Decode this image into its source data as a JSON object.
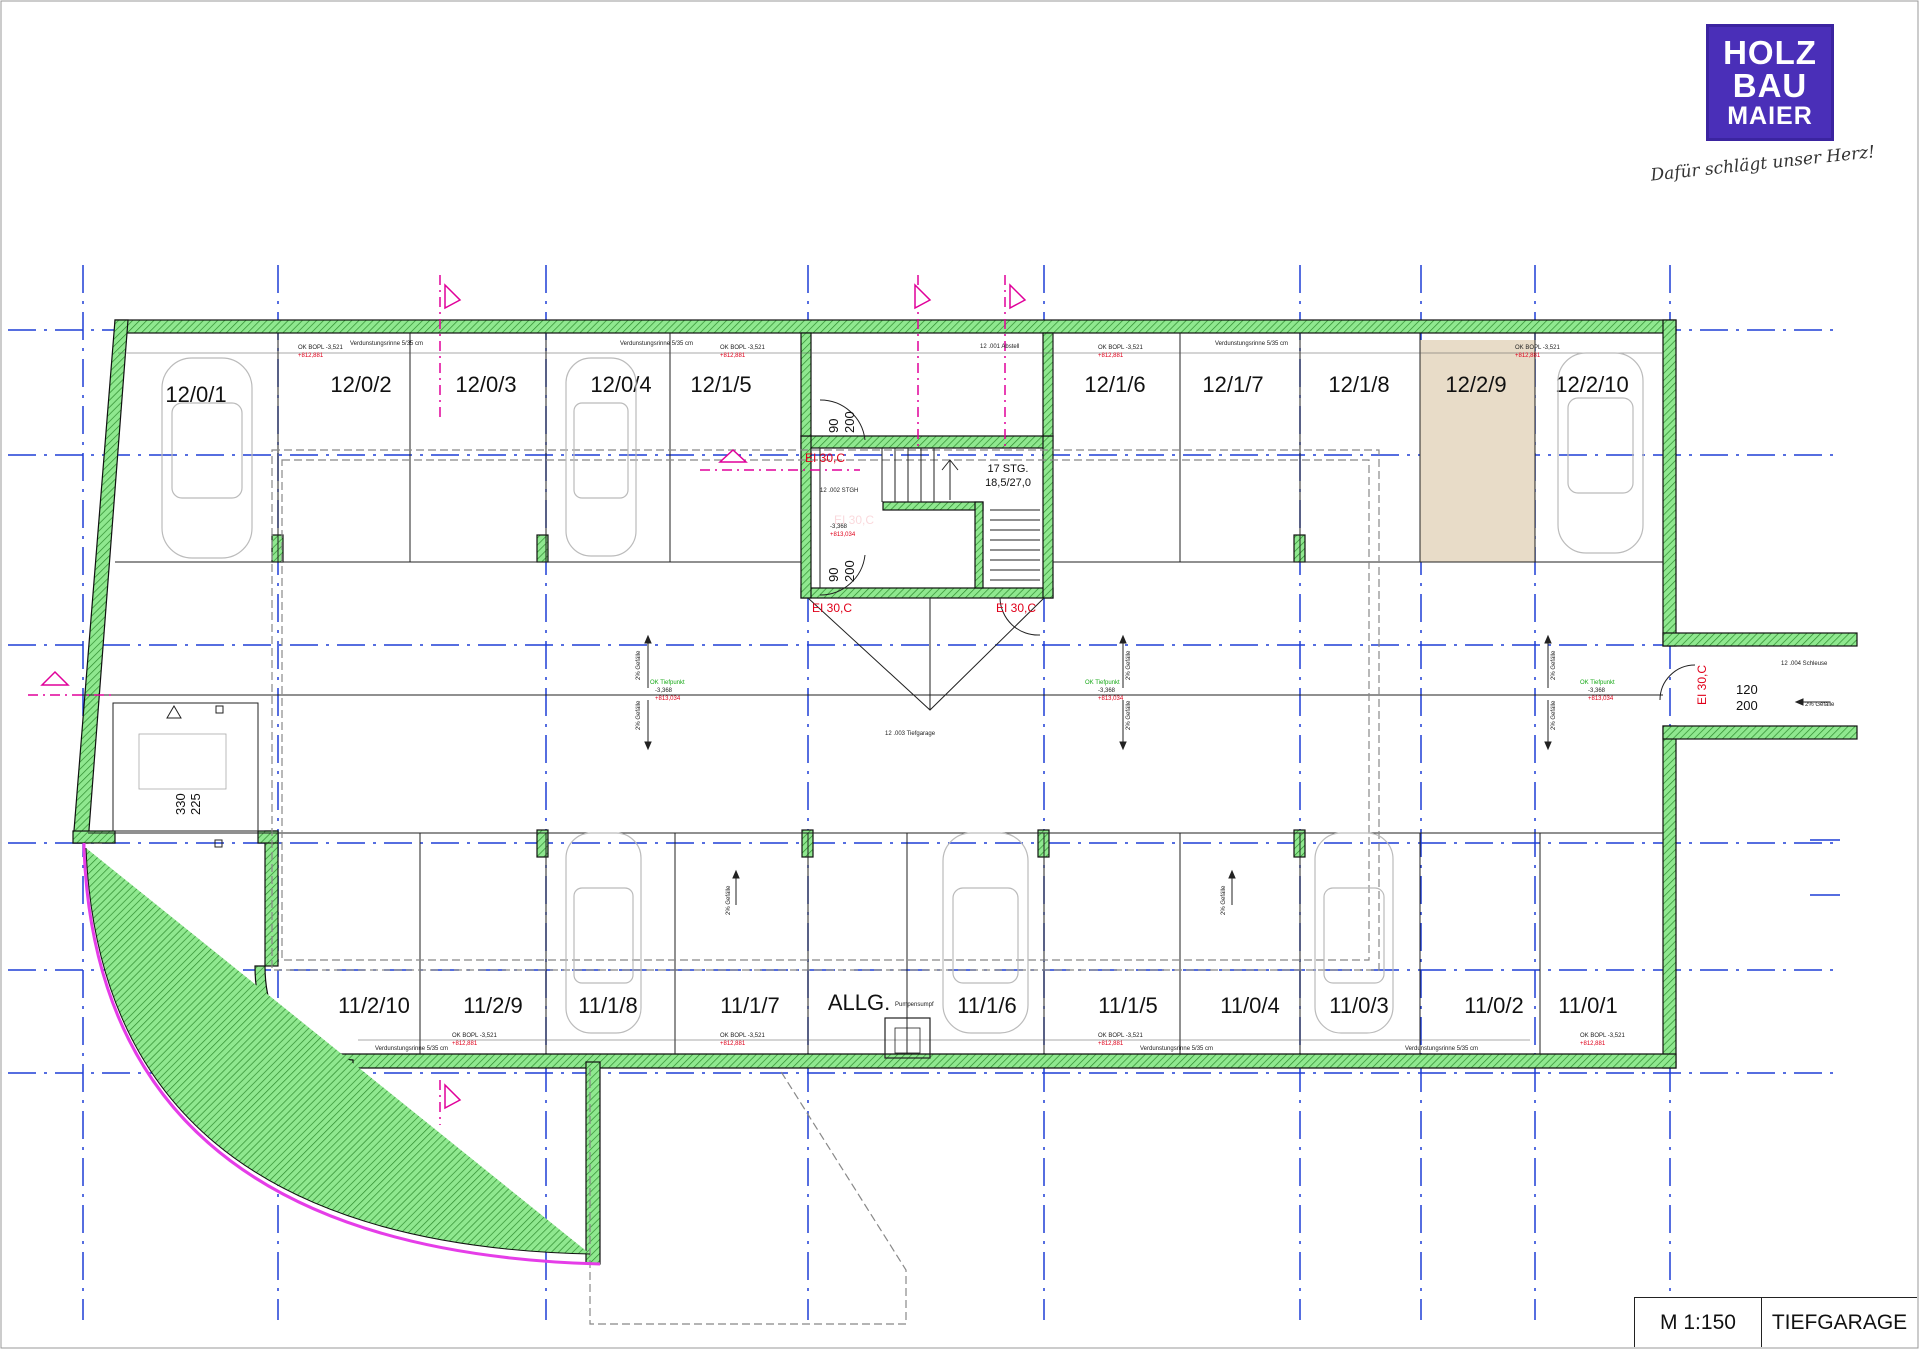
{
  "logo": {
    "line1": "HOLZ",
    "line2": "BAU",
    "line3": "MAIER",
    "color": "#4a2fb8"
  },
  "slogan": "Dafür schlägt unser Herz!",
  "title_block": {
    "scale": "M 1:150",
    "name": "TIEFGARAGE"
  },
  "colors": {
    "wall_fill": "#8fe88f",
    "wall_hatch": "#2e8b2e",
    "axis": "#1f3fd6",
    "section": "#e0009a",
    "highlight_spot": "#e8dcc8",
    "ramp_outline": "#e53de8"
  },
  "top_spots": [
    "12/0/1",
    "12/0/2",
    "12/0/3",
    "12/0/4",
    "12/1/5",
    "12/1/6",
    "12/1/7",
    "12/1/8",
    "12/2/9",
    "12/2/10"
  ],
  "bottom_spots": [
    "11/2/10",
    "11/2/9",
    "11/1/8",
    "11/1/7",
    "ALLG.",
    "11/1/6",
    "11/1/5",
    "11/0/4",
    "11/0/3",
    "11/0/2",
    "11/0/1"
  ],
  "stair": {
    "steps": "17 STG.",
    "ratio": "18,5/27,0"
  },
  "doors": {
    "fire_rating": "EI 30,C",
    "dim_top_w": "90",
    "dim_top_h": "200",
    "dim_sluice_w": "120",
    "dim_sluice_h": "200",
    "dim_lift_w": "330",
    "dim_lift_h": "225"
  },
  "small_labels": {
    "level": "OK BOPL -3,521",
    "level_abs": "+812,881",
    "drain": "Verdunstungsrinne 5/35 cm",
    "slope": "2% Gefälle",
    "room_garage": "12 .003 Tiefgarage",
    "room_stair": "12 .002 STGH",
    "room_storage": "12 .001 Abstell",
    "room_sluice": "12 .004 Schleuse",
    "pump": "Pumpensumpf",
    "lowpoint": "-3,368",
    "lowpoint_abs": "+813,034",
    "lowpoint_tag": "OK Tiefpunkt"
  }
}
